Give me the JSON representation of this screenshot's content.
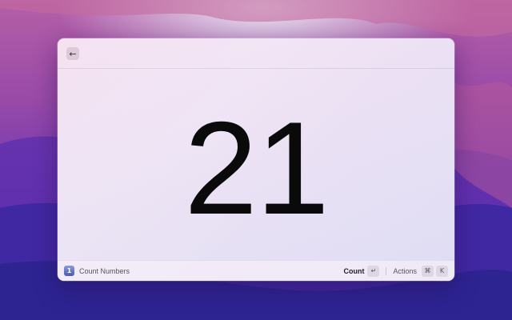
{
  "window": {
    "back_icon": "arrow-left-icon",
    "back_glyph": "←"
  },
  "main": {
    "count_value": "21"
  },
  "footer": {
    "command_icon_glyph": "1",
    "command_name": "Count Numbers",
    "primary_action_label": "Count",
    "primary_action_key": "↵",
    "actions_label": "Actions",
    "actions_modifier_key": "⌘",
    "actions_key": "K"
  },
  "colors": {
    "accent": "#4c5bb4",
    "text_primary": "#0a0a0a"
  }
}
